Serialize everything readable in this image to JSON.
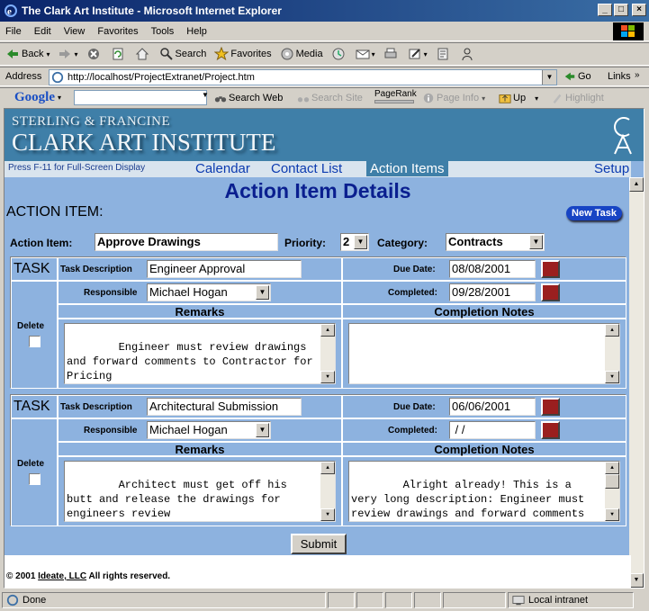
{
  "window": {
    "title": "The Clark Art Institute - Microsoft Internet Explorer"
  },
  "menu": [
    "File",
    "Edit",
    "View",
    "Favorites",
    "Tools",
    "Help"
  ],
  "toolbar": {
    "back": "Back",
    "search": "Search",
    "favorites": "Favorites",
    "media": "Media"
  },
  "address": {
    "label": "Address",
    "url": "http://localhost/ProjectExtranet/Project.htm",
    "go": "Go",
    "links": "Links"
  },
  "google": {
    "logo": "Google",
    "search_web": "Search Web",
    "search_site": "Search Site",
    "pagerank": "PageRank",
    "page_info": "Page Info",
    "up": "Up",
    "highlight": "Highlight"
  },
  "banner": {
    "line1": "STERLING & FRANCINE",
    "line2": "CLARK ART INSTITUTE"
  },
  "nav": {
    "hint": "Press F-11 for Full-Screen Display",
    "items": [
      "Calendar",
      "Contact List",
      "Action Items",
      "Setup"
    ],
    "active": "Action Items"
  },
  "page": {
    "heading": "Action Item Details",
    "action_item_label": "ACTION ITEM:",
    "new_task": "New Task",
    "fields": {
      "action_item_label": "Action Item:",
      "action_item_value": "Approve Drawings",
      "priority_label": "Priority:",
      "priority_value": "2",
      "category_label": "Category:",
      "category_value": "Contracts"
    }
  },
  "tasks": [
    {
      "task_label": "TASK",
      "desc_label": "Task Description",
      "description": "Engineer Approval",
      "due_label": "Due Date:",
      "due_date": "08/08/2001",
      "responsible_label": "Responsible",
      "responsible": "Michael Hogan",
      "completed_label": "Completed:",
      "completed": "09/28/2001",
      "delete_label": "Delete",
      "remarks_label": "Remarks",
      "notes_label": "Completion Notes",
      "remarks": "Engineer must review drawings and forward comments to Contractor for Pricing",
      "notes": ""
    },
    {
      "task_label": "TASK",
      "desc_label": "Task Description",
      "description": "Architectural Submission",
      "due_label": "Due Date:",
      "due_date": "06/06/2001",
      "responsible_label": "Responsible",
      "responsible": "Michael Hogan",
      "completed_label": "Completed:",
      "completed": " / /",
      "delete_label": "Delete",
      "remarks_label": "Remarks",
      "notes_label": "Completion Notes",
      "remarks": "Architect must get off his butt and release the drawings for engineers review",
      "notes": "Alright already! This is a very long description: Engineer must review drawings and forward comments to Contractor for Pricing"
    }
  ],
  "submit": "Submit",
  "footer": {
    "prefix": "© 2001 ",
    "company": "Ideate, LLC",
    "suffix": " All rights reserved."
  },
  "status": {
    "text": "Done",
    "zone": "Local intranet"
  }
}
